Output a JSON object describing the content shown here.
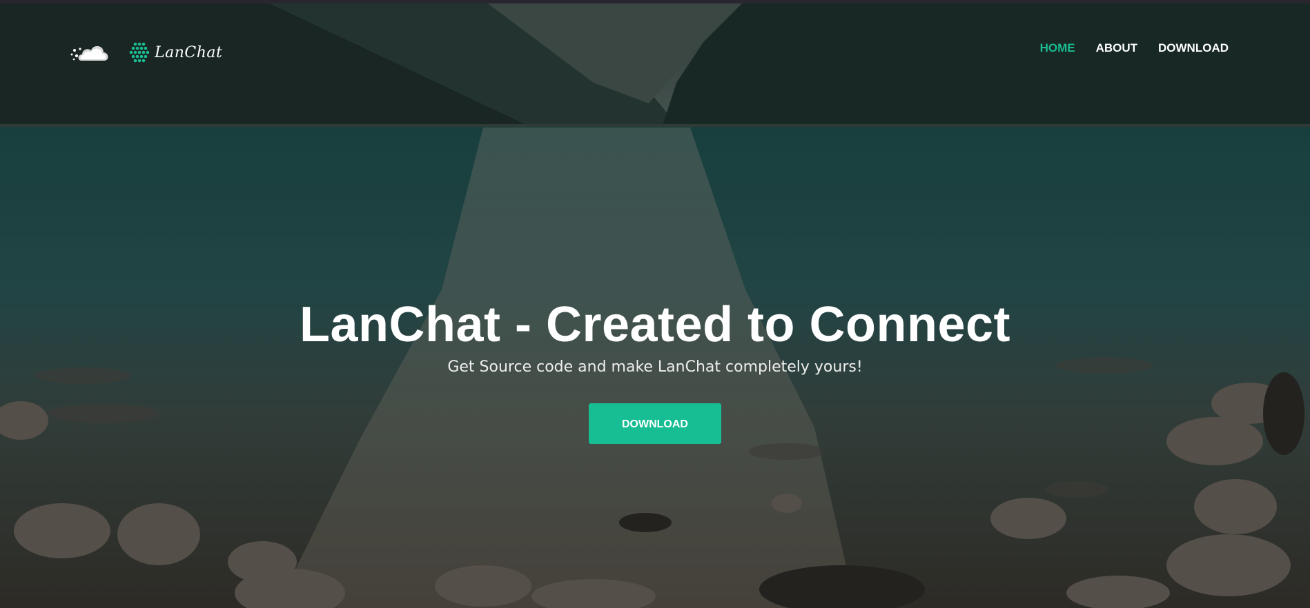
{
  "nav": {
    "logo_text": "LanChat",
    "items": [
      {
        "label": "HOME",
        "active": true
      },
      {
        "label": "ABOUT",
        "active": false
      },
      {
        "label": "DOWNLOAD",
        "active": false
      }
    ]
  },
  "hero": {
    "title": "LanChat - Created to Connect",
    "subtitle": "Get Source code and make LanChat completely yours!",
    "button_label": "DOWNLOAD"
  },
  "colors": {
    "accent": "#1bbc91",
    "button": "#17be93",
    "text": "#ffffff"
  },
  "icons": {
    "cloud": "cloud-icon",
    "logo_mark": "hexagon-dots-icon"
  }
}
